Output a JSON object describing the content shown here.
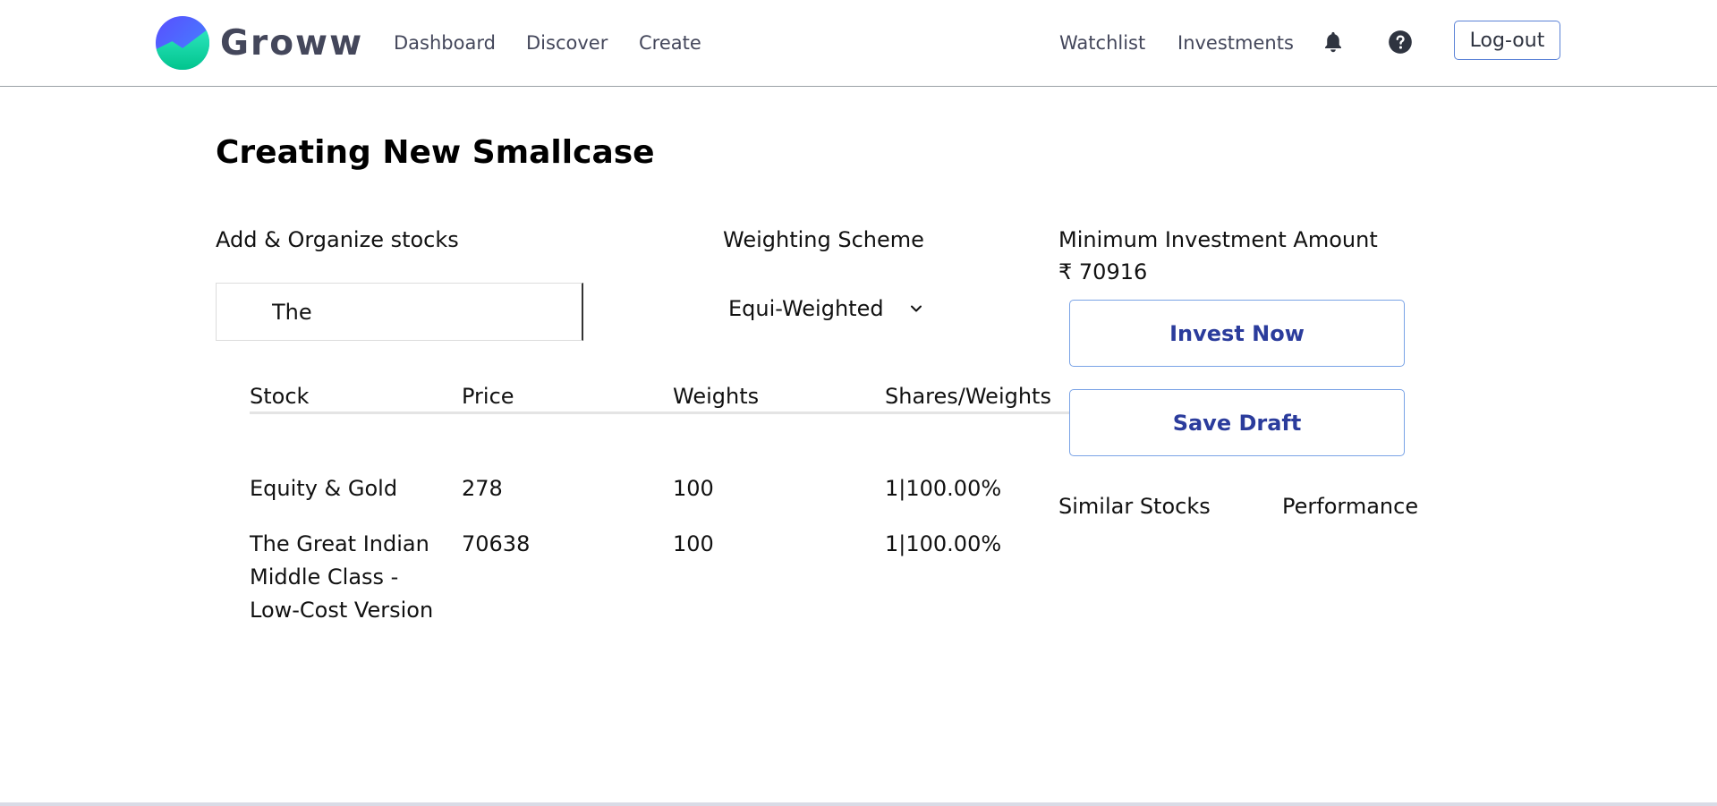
{
  "navbar": {
    "brand_name": "Groww",
    "links": {
      "dashboard": "Dashboard",
      "discover": "Discover",
      "create": "Create",
      "watchlist": "Watchlist",
      "investments": "Investments"
    },
    "icons": [
      "bell-icon",
      "help-icon"
    ],
    "logout_label": "Log-out"
  },
  "page": {
    "title": "Creating New Smallcase"
  },
  "stocks_section": {
    "label": "Add & Organize stocks",
    "search_value": "The"
  },
  "weighting": {
    "label": "Weighting Scheme",
    "selected": "Equi-Weighted"
  },
  "investment": {
    "min_label": "Minimum Investment Amount",
    "min_amount": "₹ 70916",
    "invest_label": "Invest Now",
    "save_label": "Save Draft"
  },
  "table": {
    "headers": {
      "stock": "Stock",
      "price": "Price",
      "weights": "Weights",
      "shares_weights": "Shares/Weights"
    },
    "rows": [
      {
        "stock": "Equity & Gold",
        "price": "278",
        "weights": "100",
        "shares_weights": "1|100.00%"
      },
      {
        "stock": "The Great Indian Middle Class - Low-Cost Version",
        "price": "70638",
        "weights": "100",
        "shares_weights": "1|100.00%"
      }
    ]
  },
  "similar": {
    "stocks_label": "Similar Stocks",
    "performance_label": "Performance"
  },
  "colors": {
    "brand_gradient_top": "#5367ff",
    "brand_gradient_bottom": "#00d09c",
    "button_text": "#2b3c9c",
    "button_border": "#7aa3e6",
    "nav_text": "#44475b"
  }
}
